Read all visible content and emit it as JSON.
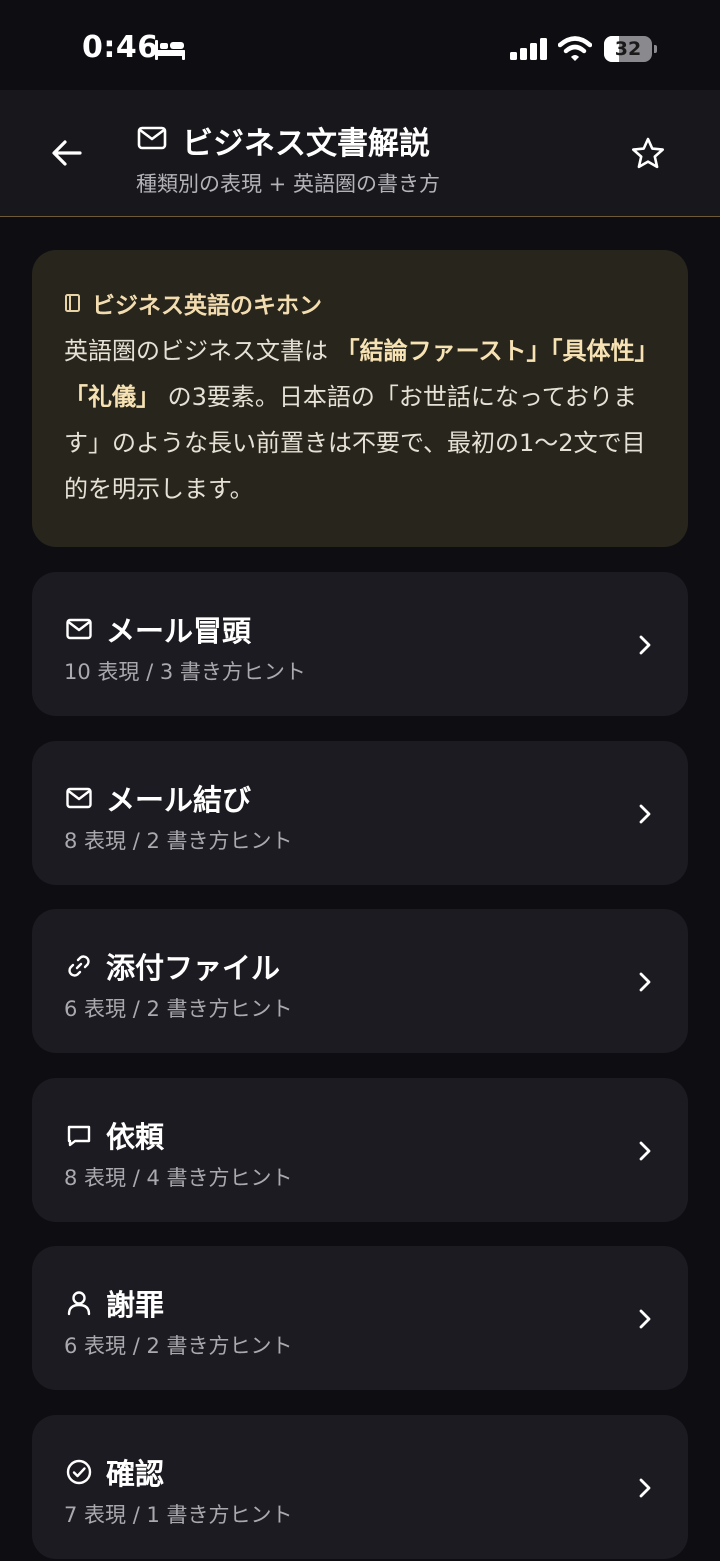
{
  "status_bar": {
    "time": "0:46",
    "battery_level": "32",
    "battery_fraction": 0.32
  },
  "header": {
    "title": "ビジネス文書解説",
    "subtitle": "種類別の表現 + 英語圏の書き方"
  },
  "info_card": {
    "title": "ビジネス英語のキホン",
    "body_pre": "英語圏のビジネス文書は ",
    "body_emphasis": "「結論ファースト」「具体性」「礼儀」",
    "body_post": " の3要素。日本語の「お世話になっております」のような長い前置きは不要で、最初の1〜2文で目的を明示します。"
  },
  "categories": [
    {
      "title": "メール冒頭",
      "meta": "10 表現 / 3 書き方ヒント",
      "icon": "mail-icon"
    },
    {
      "title": "メール結び",
      "meta": "8 表現 / 2 書き方ヒント",
      "icon": "mail-icon"
    },
    {
      "title": "添付ファイル",
      "meta": "6 表現 / 2 書き方ヒント",
      "icon": "link-icon"
    },
    {
      "title": "依頼",
      "meta": "8 表現 / 4 書き方ヒント",
      "icon": "chat-bubble-icon"
    },
    {
      "title": "謝罪",
      "meta": "6 表現 / 2 書き方ヒント",
      "icon": "person-icon"
    },
    {
      "title": "確認",
      "meta": "7 表現 / 1 書き方ヒント",
      "icon": "check-circle-icon"
    }
  ],
  "colors": {
    "background": "#0e0e12",
    "card": "#1b1b21",
    "info_card": "#28251c",
    "accent": "#f3ddb0"
  }
}
